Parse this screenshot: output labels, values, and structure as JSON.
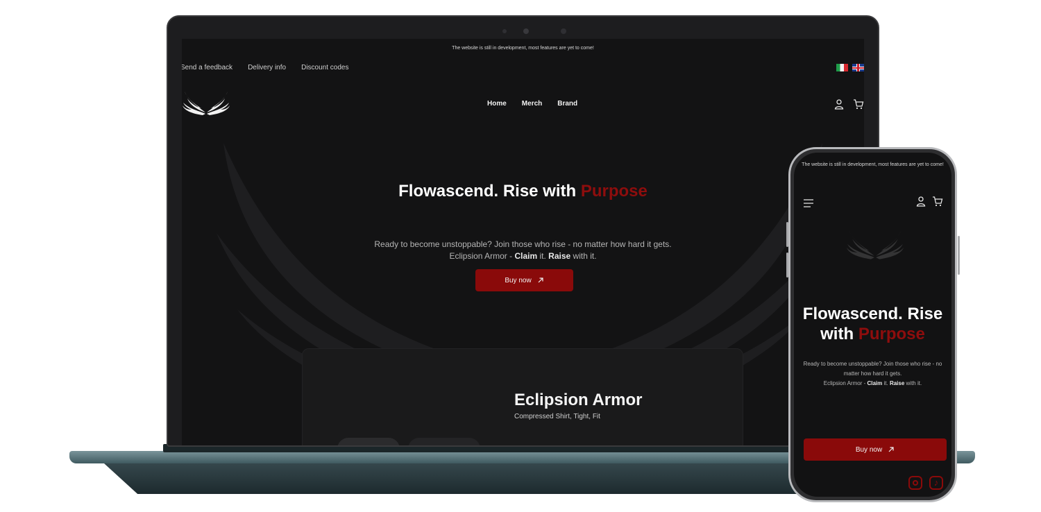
{
  "banner": "The website is still in development, most features are yet to come!",
  "top_links": [
    "Send a feedback",
    "Delivery info",
    "Discount codes"
  ],
  "languages": [
    "it-flag",
    "uk-flag"
  ],
  "nav": [
    "Home",
    "Merch",
    "Brand"
  ],
  "icons": {
    "account": "user-icon",
    "cart": "cart-icon",
    "menu": "hamburger-icon",
    "instagram": "instagram-icon",
    "tiktok": "tiktok-icon"
  },
  "hero": {
    "title_main": "Flowascend. Rise with",
    "title_accent": "Purpose",
    "subtitle_line1": "Ready to become unstoppable? Join those who rise - no matter how hard it gets.",
    "subtitle_line2_pre": "Eclipsion Armor - ",
    "subtitle_claim": "Claim",
    "subtitle_mid": " it. ",
    "subtitle_raise": "Raise",
    "subtitle_end": " with it.",
    "buy_label": "Buy now"
  },
  "product": {
    "title": "Eclipsion Armor",
    "subtitle": "Compressed Shirt, Tight, Fit"
  },
  "mobile": {
    "banner": "The website is still in development, most features are yet to come!",
    "title_main": "Flowascend. Rise with",
    "title_accent": "Purpose",
    "subtitle_line1": "Ready to become unstoppable? Join those who rise - no matter how hard it gets.",
    "subtitle_line2_pre": "Eclipsion Armor - ",
    "subtitle_claim": "Claim",
    "subtitle_mid": " it. ",
    "subtitle_raise": "Raise",
    "subtitle_end": " with it.",
    "buy_label": "Buy now"
  },
  "colors": {
    "accent": "#8e0d0d",
    "background": "#131314",
    "button": "#8a0a0a"
  }
}
